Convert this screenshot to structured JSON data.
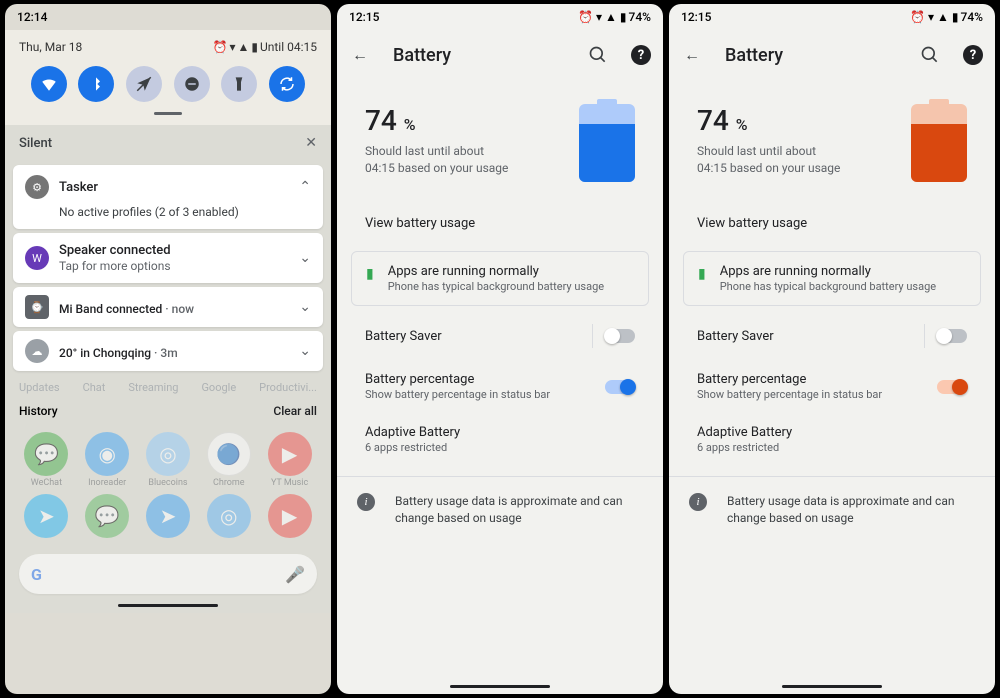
{
  "screen1": {
    "time": "12:14",
    "date": "Thu, Mar 18",
    "until": "Until 04:15",
    "silent_label": "Silent",
    "history_label": "History",
    "clear_all": "Clear all",
    "under_tabs": [
      "Updates",
      "Chat",
      "Streaming",
      "Google",
      "Productivi..."
    ],
    "notifs": [
      {
        "app": "Tasker",
        "body": "No active profiles (2 of 3 enabled)"
      },
      {
        "title": "Speaker connected",
        "sub": "Tap for more options"
      },
      {
        "title": "Mi Band connected",
        "meta": " · now"
      },
      {
        "title": "20° in Chongqing",
        "meta": " · 3m"
      }
    ],
    "apps_row1": [
      "WeChat",
      "Inoreader",
      "Bluecoins",
      "Chrome",
      "YT Music"
    ],
    "apps_row2": [
      "",
      "",
      "",
      "",
      ""
    ]
  },
  "screen2": {
    "time": "12:15",
    "status_pct": "74%",
    "title": "Battery",
    "pct": "74",
    "pct_unit": "%",
    "est_line1": "Should last until about",
    "est_line2": "04:15 based on your usage",
    "view_usage": "View battery usage",
    "card_title": "Apps are running normally",
    "card_sub": "Phone has typical background battery usage",
    "saver": "Battery Saver",
    "pct_title": "Battery percentage",
    "pct_sub": "Show battery percentage in status bar",
    "adaptive_title": "Adaptive Battery",
    "adaptive_sub": "6 apps restricted",
    "footer": "Battery usage data is approximate and can change based on usage",
    "accent": "#1a73e8",
    "batt_bg": "#aecbfa",
    "fill_pct": 74
  },
  "screen3": {
    "time": "12:15",
    "status_pct": "74%",
    "title": "Battery",
    "pct": "74",
    "pct_unit": "%",
    "est_line1": "Should last until about",
    "est_line2": "04:15 based on your usage",
    "view_usage": "View battery usage",
    "card_title": "Apps are running normally",
    "card_sub": "Phone has typical background battery usage",
    "saver": "Battery Saver",
    "pct_title": "Battery percentage",
    "pct_sub": "Show battery percentage in status bar",
    "adaptive_title": "Adaptive Battery",
    "adaptive_sub": "6 apps restricted",
    "footer": "Battery usage data is approximate and can change based on usage",
    "accent": "#d9480f",
    "batt_bg": "#f5c5ad",
    "fill_pct": 74
  }
}
